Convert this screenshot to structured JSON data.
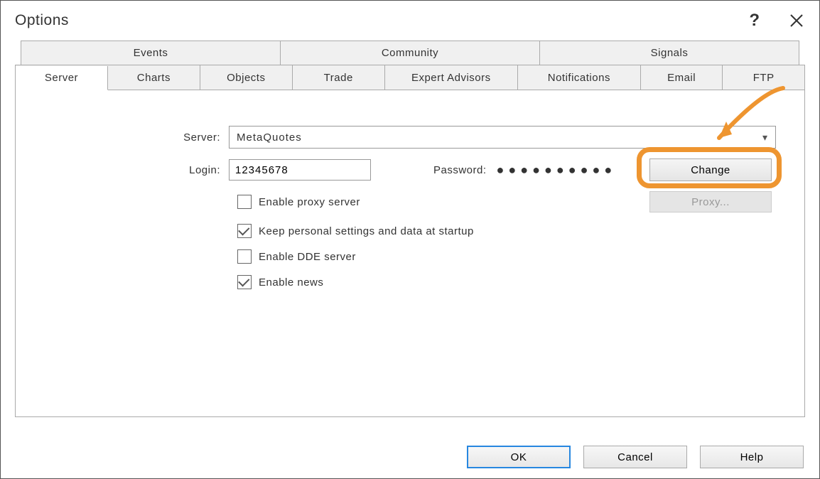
{
  "window": {
    "title": "Options"
  },
  "tabs_back": [
    "Events",
    "Community",
    "Signals"
  ],
  "tabs_front": [
    "Server",
    "Charts",
    "Objects",
    "Trade",
    "Expert Advisors",
    "Notifications",
    "Email",
    "FTP"
  ],
  "active_front_tab_index": 0,
  "form": {
    "server_label": "Server:",
    "server_value": "MetaQuotes",
    "login_label": "Login:",
    "login_value": "12345678",
    "password_label": "Password:",
    "password_mask": "●●●●●●●●●●",
    "change_label": "Change",
    "proxy_button": "Proxy...",
    "checkboxes": [
      {
        "label": "Enable proxy server",
        "checked": false
      },
      {
        "label": "Keep personal settings and data at startup",
        "checked": true
      },
      {
        "label": "Enable DDE server",
        "checked": false
      },
      {
        "label": "Enable news",
        "checked": true
      }
    ]
  },
  "footer": {
    "ok": "OK",
    "cancel": "Cancel",
    "help": "Help"
  },
  "annotation": {
    "highlight_color": "#EE9530"
  }
}
